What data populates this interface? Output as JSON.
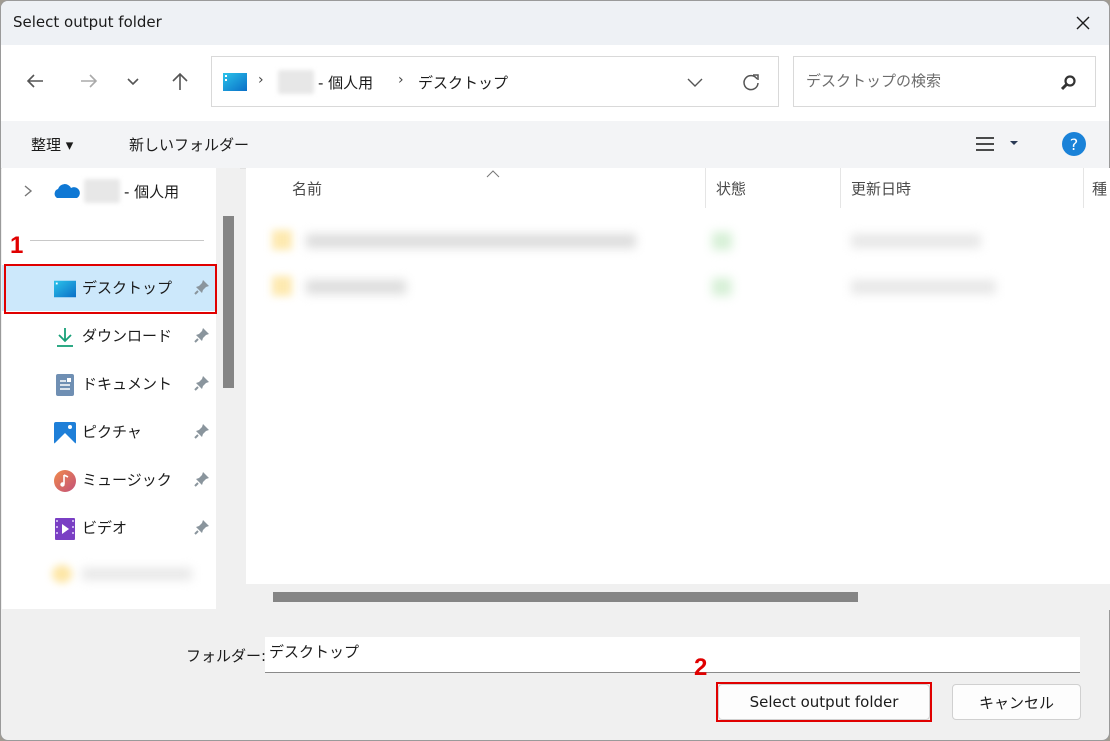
{
  "window": {
    "title": "Select output folder"
  },
  "nav": {
    "back": "back-arrow",
    "forward": "forward-arrow",
    "recent": "chevron-down",
    "up": "up-arrow"
  },
  "address": {
    "crumbs": [
      {
        "label": "- 個人用"
      },
      {
        "label": "デスクトップ"
      }
    ],
    "separator": "›"
  },
  "search": {
    "placeholder": "デスクトップの検索"
  },
  "commands": {
    "organize": "整理 ▾",
    "new_folder": "新しいフォルダー"
  },
  "sidebar": {
    "onedrive": {
      "label": "- 個人用"
    },
    "items": [
      {
        "label": "デスクトップ",
        "icon": "desktop-icon",
        "selected": true
      },
      {
        "label": "ダウンロード",
        "icon": "download-icon"
      },
      {
        "label": "ドキュメント",
        "icon": "document-icon"
      },
      {
        "label": "ピクチャ",
        "icon": "pictures-icon"
      },
      {
        "label": "ミュージック",
        "icon": "music-icon"
      },
      {
        "label": "ビデオ",
        "icon": "video-icon"
      }
    ]
  },
  "columns": {
    "name": "名前",
    "status": "状態",
    "modified": "更新日時",
    "type": "種"
  },
  "footer": {
    "folder_label": "フォルダー:",
    "folder_value": "デスクトップ",
    "select_button": "Select output folder",
    "cancel_button": "キャンセル"
  },
  "annotations": {
    "step1": "1",
    "step2": "2"
  },
  "colors": {
    "accent": "#0078d4",
    "highlight": "#e00000",
    "selection": "#cce8fb"
  }
}
